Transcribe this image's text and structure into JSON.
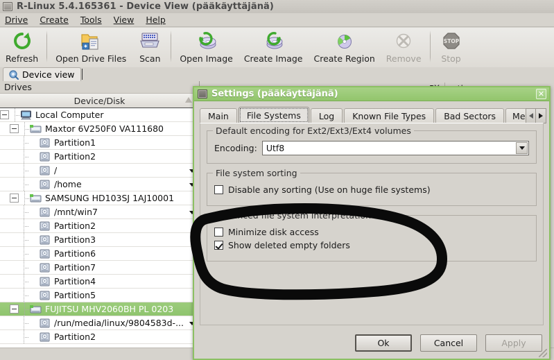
{
  "window": {
    "title": "R-Linux 5.4.165361 - Device View (pääkäyttäjänä)",
    "menus": [
      {
        "label": "Drive"
      },
      {
        "label": "Create"
      },
      {
        "label": "Tools"
      },
      {
        "label": "View"
      },
      {
        "label": "Help"
      }
    ],
    "toolbar": [
      {
        "label": "Refresh",
        "icon": "refresh-icon",
        "disabled": false
      },
      {
        "label": "Open Drive Files",
        "icon": "open-folder-icon",
        "disabled": false
      },
      {
        "label": "Scan",
        "icon": "scan-disk-icon",
        "disabled": false
      },
      {
        "label": "Open Image",
        "icon": "open-image-icon",
        "disabled": false
      },
      {
        "label": "Create Image",
        "icon": "create-image-icon",
        "disabled": false
      },
      {
        "label": "Create Region",
        "icon": "create-region-icon",
        "disabled": false
      },
      {
        "label": "Remove",
        "icon": "remove-icon",
        "disabled": true
      },
      {
        "label": "Stop",
        "icon": "stop-icon",
        "disabled": true
      }
    ],
    "view_tab": {
      "label": "Device view",
      "icon": "device-view-icon"
    }
  },
  "drives_pane": {
    "header": "Drives",
    "column_header": "Device/Disk",
    "sort_icon": "sort-ascending-icon",
    "tree": [
      {
        "label": "Local Computer",
        "depth": 0,
        "icon": "computer-icon",
        "expander": "minus",
        "selected": false,
        "dropdown": false
      },
      {
        "label": "Maxtor 6V250F0 VA111680",
        "depth": 1,
        "icon": "disk-icon",
        "expander": "minus",
        "selected": false,
        "dropdown": false
      },
      {
        "label": "Partition1",
        "depth": 2,
        "icon": "partition-icon",
        "expander": "none",
        "selected": false,
        "dropdown": false
      },
      {
        "label": "Partition2",
        "depth": 2,
        "icon": "partition-icon",
        "expander": "none",
        "selected": false,
        "dropdown": false
      },
      {
        "label": "/",
        "depth": 2,
        "icon": "partition-icon",
        "expander": "none",
        "selected": false,
        "dropdown": true
      },
      {
        "label": "/home",
        "depth": 2,
        "icon": "partition-icon",
        "expander": "none",
        "selected": false,
        "dropdown": true
      },
      {
        "label": "SAMSUNG HD103SJ 1AJ10001",
        "depth": 1,
        "icon": "disk-icon",
        "expander": "minus",
        "selected": false,
        "dropdown": false
      },
      {
        "label": "/mnt/win7",
        "depth": 2,
        "icon": "partition-icon",
        "expander": "none",
        "selected": false,
        "dropdown": true
      },
      {
        "label": "Partition2",
        "depth": 2,
        "icon": "partition-icon",
        "expander": "none",
        "selected": false,
        "dropdown": false
      },
      {
        "label": "Partition3",
        "depth": 2,
        "icon": "partition-icon",
        "expander": "none",
        "selected": false,
        "dropdown": false
      },
      {
        "label": "Partition6",
        "depth": 2,
        "icon": "partition-icon",
        "expander": "none",
        "selected": false,
        "dropdown": false
      },
      {
        "label": "Partition7",
        "depth": 2,
        "icon": "partition-icon",
        "expander": "none",
        "selected": false,
        "dropdown": false
      },
      {
        "label": "Partition4",
        "depth": 2,
        "icon": "partition-icon",
        "expander": "none",
        "selected": false,
        "dropdown": false
      },
      {
        "label": "Partition5",
        "depth": 2,
        "icon": "partition-icon",
        "expander": "none",
        "selected": false,
        "dropdown": false
      },
      {
        "label": "FUJITSU MHV2060BH PL 0203",
        "depth": 1,
        "icon": "disk-icon",
        "expander": "minus",
        "selected": true,
        "dropdown": false
      },
      {
        "label": "/run/media/linux/9804583d-...",
        "depth": 2,
        "icon": "partition-icon",
        "expander": "none",
        "selected": false,
        "dropdown": true
      },
      {
        "label": "Partition2",
        "depth": 2,
        "icon": "partition-icon",
        "expander": "none",
        "selected": false,
        "dropdown": false
      }
    ]
  },
  "properties_pane": {
    "title": "Properties",
    "close_icon": "close-x-icon"
  },
  "dialog": {
    "title": "Settings (pääkäyttäjänä)",
    "close_icon": "close-icon",
    "tabs": [
      {
        "label": "Main",
        "active": false,
        "clipped": false
      },
      {
        "label": "File Systems",
        "active": true,
        "clipped": false
      },
      {
        "label": "Log",
        "active": false,
        "clipped": false
      },
      {
        "label": "Known File Types",
        "active": false,
        "clipped": false
      },
      {
        "label": "Bad Sectors",
        "active": false,
        "clipped": false
      },
      {
        "label": "Mer",
        "active": false,
        "clipped": true
      }
    ],
    "tab_scroll": {
      "left_icon": "scroll-left-icon",
      "right_icon": "scroll-right-icon"
    },
    "groups": [
      {
        "title": "Default encoding for Ext2/Ext3/Ext4 volumes",
        "field_label": "Encoding:",
        "field_value": "Utf8",
        "dropdown_icon": "chevron-down-icon"
      },
      {
        "title": "File system sorting",
        "checkboxes": [
          {
            "label": "Disable any sorting (Use on huge file systems)",
            "checked": false
          }
        ]
      },
      {
        "title": "Advanced file system interpretation",
        "checkboxes": [
          {
            "label": "Minimize disk access",
            "checked": false
          },
          {
            "label": "Show deleted empty folders",
            "checked": true
          }
        ]
      }
    ],
    "buttons": [
      {
        "label": "Ok",
        "mnemonic": "O",
        "default": true,
        "disabled": false
      },
      {
        "label": "Cancel",
        "mnemonic": "C",
        "default": false,
        "disabled": false
      },
      {
        "label": "Apply",
        "mnemonic": "A",
        "default": false,
        "disabled": true
      }
    ],
    "resize_grip_icon": "resize-grip-icon"
  },
  "annotation": {
    "shape": "hand-drawn-circle",
    "color": "#000000"
  },
  "colors": {
    "dialog_titlebar": "#92c56c",
    "selection": "#8fc46e",
    "window_chrome": "#d6d3cd"
  }
}
